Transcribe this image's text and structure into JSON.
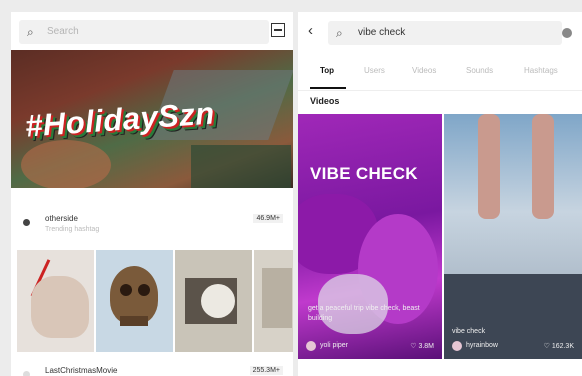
{
  "left": {
    "search": {
      "placeholder": "Search"
    },
    "banner": {
      "hashtag": "#HolidaySzn"
    },
    "hashtags": [
      {
        "title": "otherside",
        "subtitle": "Trending hashtag",
        "count": "46.9M+"
      },
      {
        "title": "LastChristmasMovie",
        "subtitle": "",
        "count": "255.3M+"
      }
    ]
  },
  "right": {
    "search": {
      "query": "vibe check"
    },
    "tabs": [
      "Top",
      "Users",
      "Videos",
      "Sounds",
      "Hashtags"
    ],
    "section_title": "Videos",
    "videos": [
      {
        "headline": "VIBE CHECK",
        "caption": "get a peaceful trip vibe check, beast building",
        "user": "yoli piper",
        "likes": "3.8M"
      },
      {
        "caption": "vibe check",
        "user": "hyrainbow",
        "likes": "162.3K"
      }
    ]
  },
  "colors": {
    "purple": "#a028b8",
    "background": "#ececec"
  },
  "icons": [
    "search-icon",
    "scan-icon",
    "back-icon",
    "clear-icon",
    "hashtag-icon",
    "heart-icon"
  ]
}
